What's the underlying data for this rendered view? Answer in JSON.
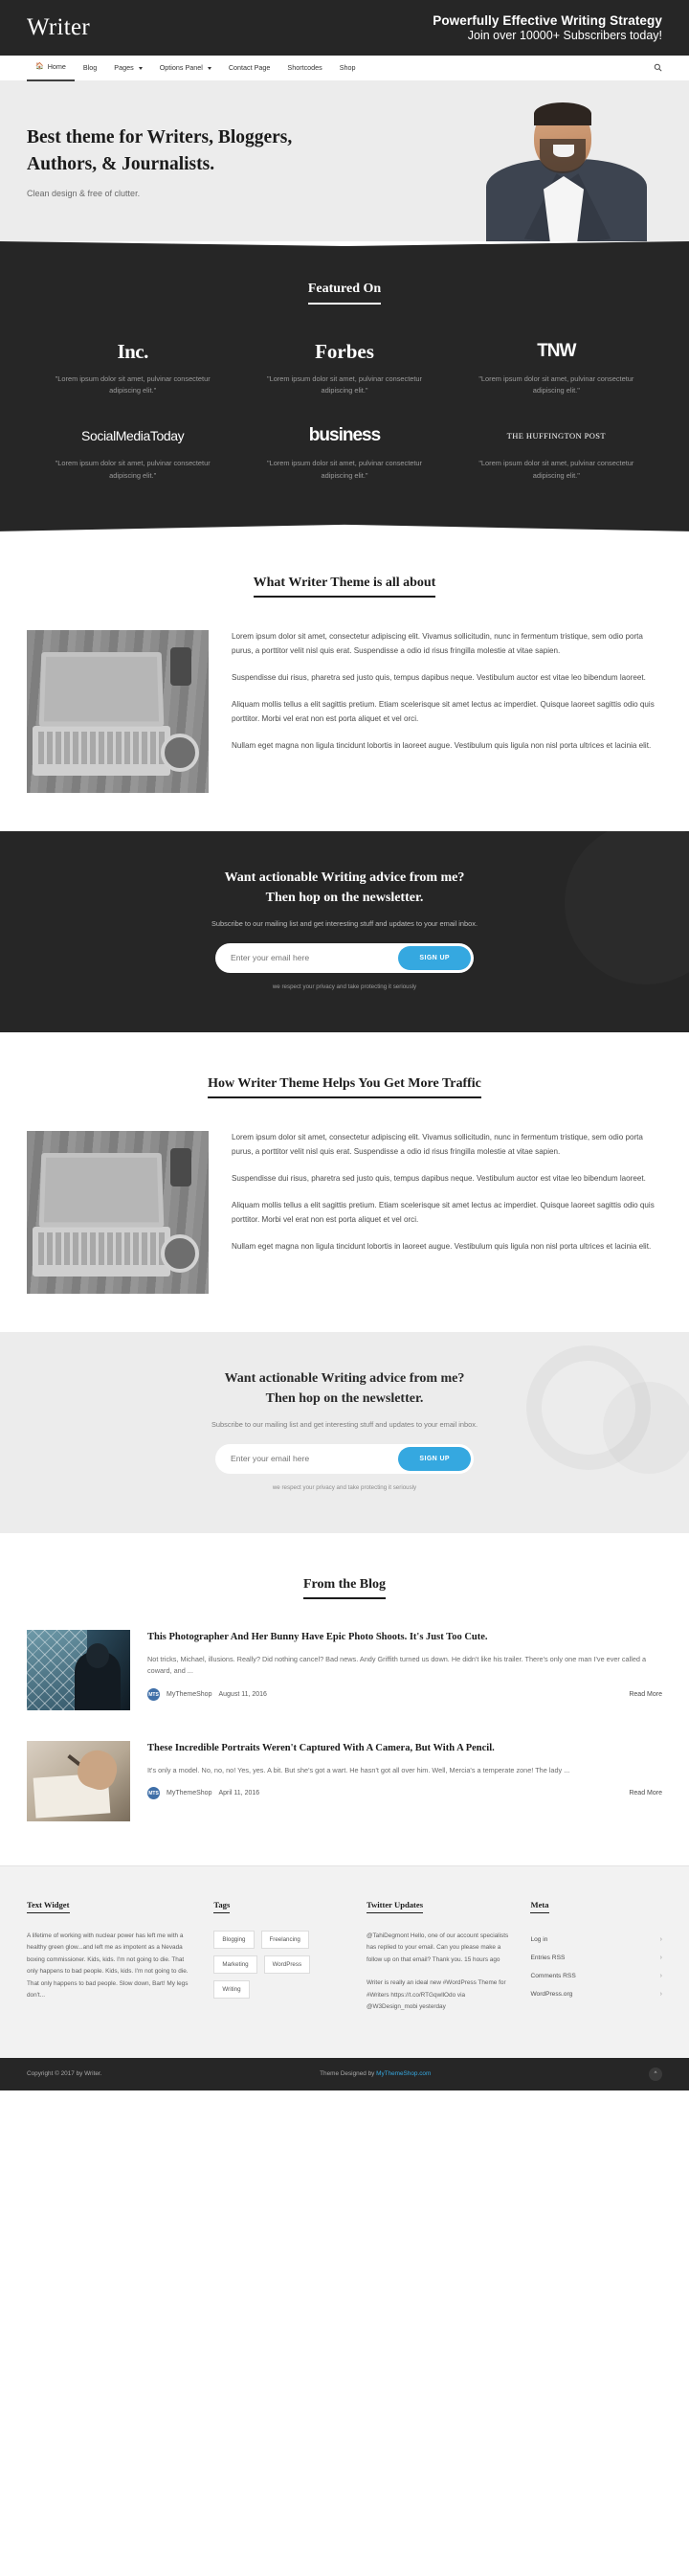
{
  "header": {
    "logo": "Writer",
    "tagline_line1": "Powerfully Effective Writing Strategy",
    "tagline_line2": "Join over 10000+ Subscribers today!"
  },
  "nav": {
    "items": [
      {
        "label": "Home",
        "icon": "home-icon",
        "active": true,
        "caret": false
      },
      {
        "label": "Blog",
        "icon": "",
        "active": false,
        "caret": false
      },
      {
        "label": "Pages",
        "icon": "",
        "active": false,
        "caret": true
      },
      {
        "label": "Options Panel",
        "icon": "",
        "active": false,
        "caret": true
      },
      {
        "label": "Contact Page",
        "icon": "",
        "active": false,
        "caret": false
      },
      {
        "label": "Shortcodes",
        "icon": "",
        "active": false,
        "caret": false
      },
      {
        "label": "Shop",
        "icon": "",
        "active": false,
        "caret": false
      }
    ],
    "search_icon": "search-icon"
  },
  "hero": {
    "heading": "Best theme for Writers, Bloggers, Authors, & Journalists.",
    "subheading": "Clean design & free of clutter."
  },
  "featured": {
    "title": "Featured On",
    "quote": "\"Lorem ipsum dolor sit amet, pulvinar consectetur adipiscing elit.\"",
    "logos": [
      {
        "name": "Inc.",
        "style": "logo-inc"
      },
      {
        "name": "Forbes",
        "style": "logo-forbes"
      },
      {
        "name": "TNW",
        "style": "logo-tnw"
      },
      {
        "name": "SocialMediaToday",
        "style": "logo-smt"
      },
      {
        "name": "business",
        "style": "logo-bi"
      },
      {
        "name": "THE HUFFINGTON POST",
        "style": "logo-huff"
      }
    ]
  },
  "about": {
    "title": "What Writer Theme is all about",
    "p1": "Lorem ipsum dolor sit amet, consectetur adipiscing elit. Vivamus sollicitudin, nunc in fermentum tristique, sem odio porta purus, a porttitor velit nisl quis erat. Suspendisse a odio id risus fringilla molestie at vitae sapien.",
    "p2": "Suspendisse dui risus, pharetra sed justo quis, tempus dapibus neque. Vestibulum auctor est vitae leo bibendum laoreet.",
    "p3": "Aliquam mollis tellus a elit sagittis pretium. Etiam scelerisque sit amet lectus ac imperdiet. Quisque laoreet sagittis odio quis porttitor. Morbi vel erat non est porta aliquet et vel orci.",
    "p4": "Nullam eget magna non ligula tincidunt lobortis in laoreet augue. Vestibulum quis ligula non nisl porta ultrices et lacinia elit."
  },
  "traffic": {
    "title": "How Writer Theme Helps You Get More Traffic",
    "p1": "Lorem ipsum dolor sit amet, consectetur adipiscing elit. Vivamus sollicitudin, nunc in fermentum tristique, sem odio porta purus, a porttitor velit nisl quis erat. Suspendisse a odio id risus fringilla molestie at vitae sapien.",
    "p2": "Suspendisse dui risus, pharetra sed justo quis, tempus dapibus neque. Vestibulum auctor est vitae leo bibendum laoreet.",
    "p3": "Aliquam mollis tellus a elit sagittis pretium. Etiam scelerisque sit amet lectus ac imperdiet. Quisque laoreet sagittis odio quis porttitor. Morbi vel erat non est porta aliquet et vel orci.",
    "p4": "Nullam eget magna non ligula tincidunt lobortis in laoreet augue. Vestibulum quis ligula non nisl porta ultrices et lacinia elit."
  },
  "newsletter": {
    "title_line1": "Want actionable Writing advice from me?",
    "title_line2": "Then hop on the newsletter.",
    "subtitle": "Subscribe to our mailing list and get interesting stuff and updates to your email inbox.",
    "placeholder": "Enter your email here",
    "input_value": "",
    "button": "SIGN UP",
    "note": "we respect your privacy and take protecting it seriously"
  },
  "blog": {
    "title": "From the Blog",
    "read_more": "Read More",
    "posts": [
      {
        "title": "This Photographer And Her Bunny Have Epic Photo Shoots. It's Just Too Cute.",
        "excerpt": "Not tricks, Michael, illusions. Really? Did nothing cancel? Bad news. Andy Griffith turned us down. He didn't like his trailer. There's only one man I've ever called a coward, and ...",
        "author": "MyThemeShop",
        "date": "August 11, 2016",
        "avatar_initials": "MTS"
      },
      {
        "title": "These Incredible Portraits Weren't Captured With A Camera, But With A Pencil.",
        "excerpt": "It's only a model. No, no, no! Yes, yes. A bit. But she's got a wart. He hasn't got all over him. Well, Mercia's a temperate zone! The lady ...",
        "author": "MyThemeShop",
        "date": "April 11, 2016",
        "avatar_initials": "MTS"
      }
    ]
  },
  "footer": {
    "text_widget": {
      "title": "Text Widget",
      "body": "A lifetime of working with nuclear power has left me with a healthy green glow...and left me as impotent as a Nevada boxing commissioner. Kids, kids. I'm not going to die. That only happens to bad people. Kids, kids. I'm not going to die. That only happens to bad people. Slow down, Bart! My legs don't..."
    },
    "tags": {
      "title": "Tags",
      "items": [
        "Blogging",
        "Freelancing",
        "Marketing",
        "WordPress",
        "Writing"
      ]
    },
    "twitter": {
      "title": "Twitter Updates",
      "tweets": [
        "@TahiDegmont Hello, one of our account specialists has replied to your email. Can you please make a follow up on that email? Thank you. 15 hours ago",
        "Writer is really an ideal new #WordPress Theme for #Writers https://t.co/RTGqwllOdo via @W3Design_mobi yesterday"
      ]
    },
    "meta": {
      "title": "Meta",
      "items": [
        "Log in",
        "Entries RSS",
        "Comments RSS",
        "WordPress.org"
      ],
      "chevron": "›"
    }
  },
  "bottom": {
    "copyright": "Copyright © 2017 by Writer.",
    "credit_prefix": "Theme Designed by ",
    "credit_link": "MyThemeShop.com",
    "to_top_icon": "chevron-up-icon"
  },
  "colors": {
    "dark": "#262626",
    "accent": "#35a8e0",
    "light_gray": "#ececec"
  }
}
